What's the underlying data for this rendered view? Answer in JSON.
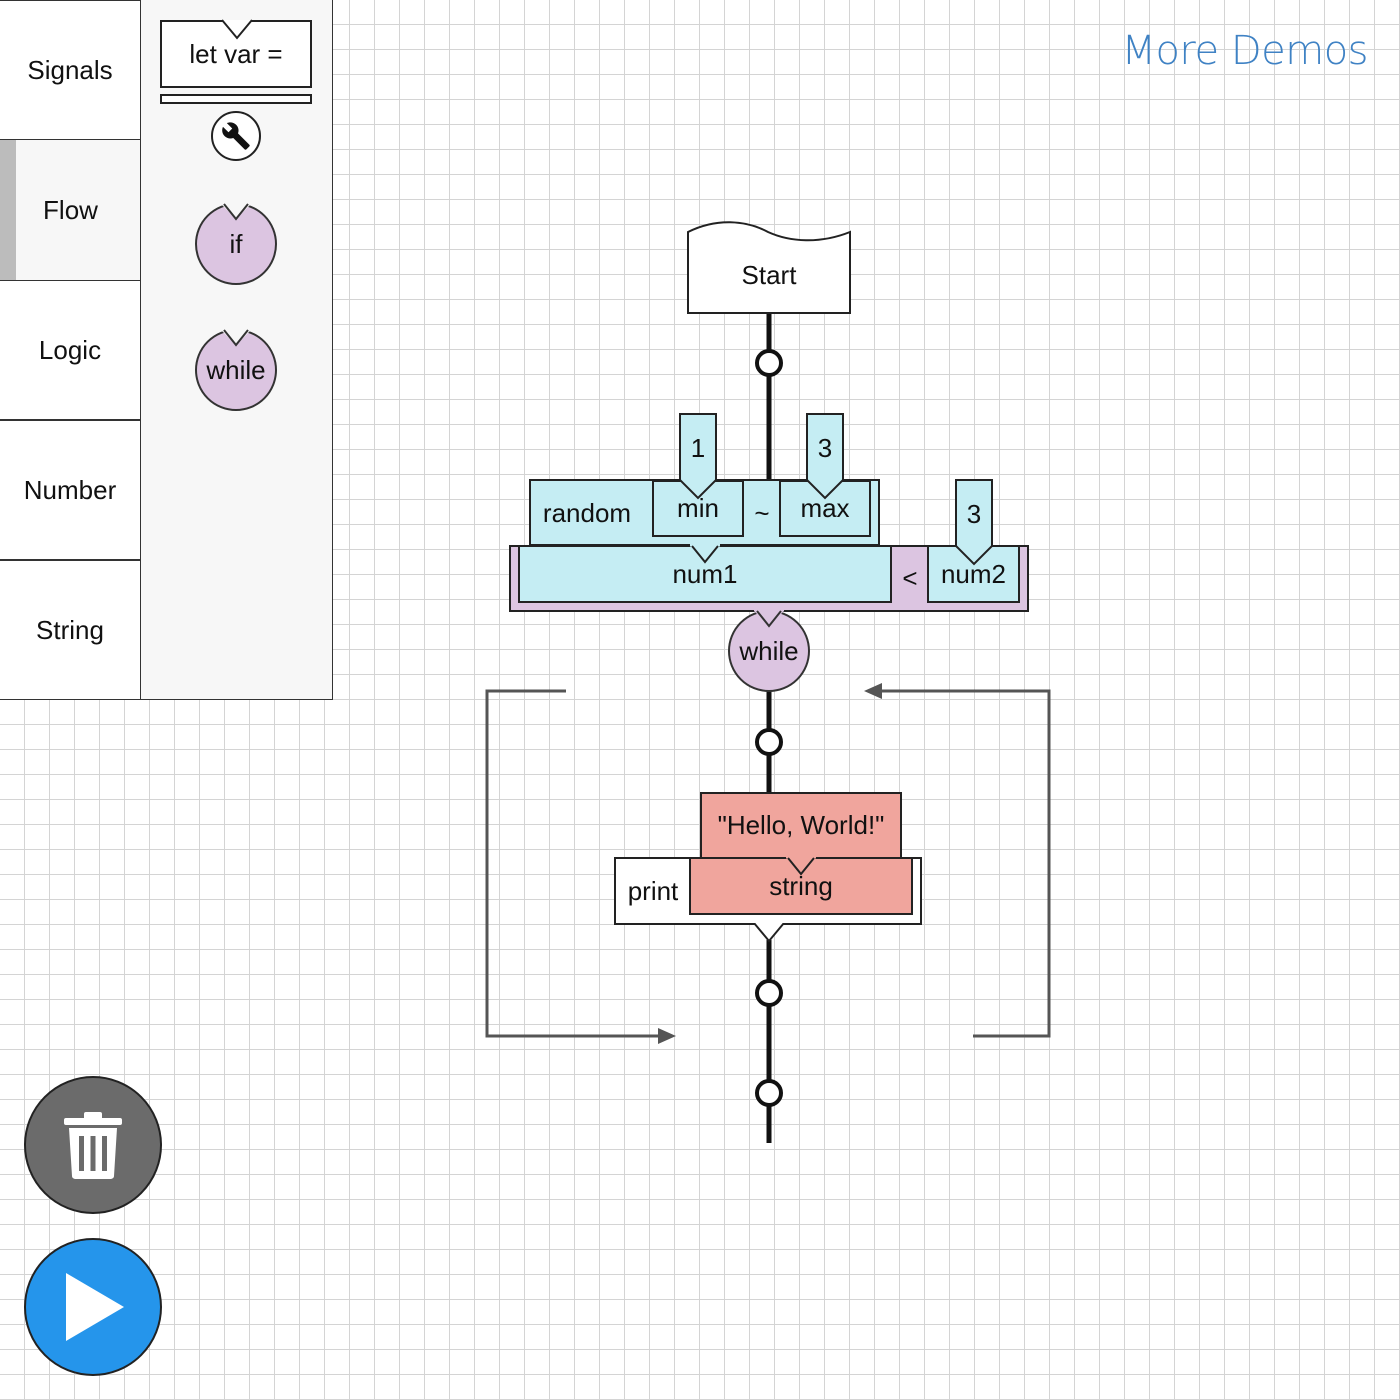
{
  "palette": {
    "categories": [
      {
        "label": "Signals"
      },
      {
        "label": "Flow"
      },
      {
        "label": "Logic"
      },
      {
        "label": "Number"
      },
      {
        "label": "String"
      }
    ],
    "active_category": "Flow",
    "blocks": {
      "let_var": "let var =",
      "if": "if",
      "while": "while"
    }
  },
  "header": {
    "more_demos": "More Demos"
  },
  "program": {
    "start": "Start",
    "random": "random",
    "min_label": "min",
    "min_value": "1",
    "tilde": "~",
    "max_label": "max",
    "max_value": "3",
    "num1": "num1",
    "less_than": "<",
    "num2": "num2",
    "num2_value": "3",
    "while": "while",
    "hello_world": "\"Hello, World!\"",
    "print": "print",
    "string": "string"
  },
  "colors": {
    "number_block": "#c5edf3",
    "flow_block": "#dcc5e1",
    "string_block": "#f0a59d",
    "link": "#3f82c4",
    "run_button": "#2595eb",
    "trash_button": "#6b6b6b"
  },
  "icons": {
    "settings": "wrench-icon",
    "delete": "trash-icon",
    "run": "play-icon"
  }
}
